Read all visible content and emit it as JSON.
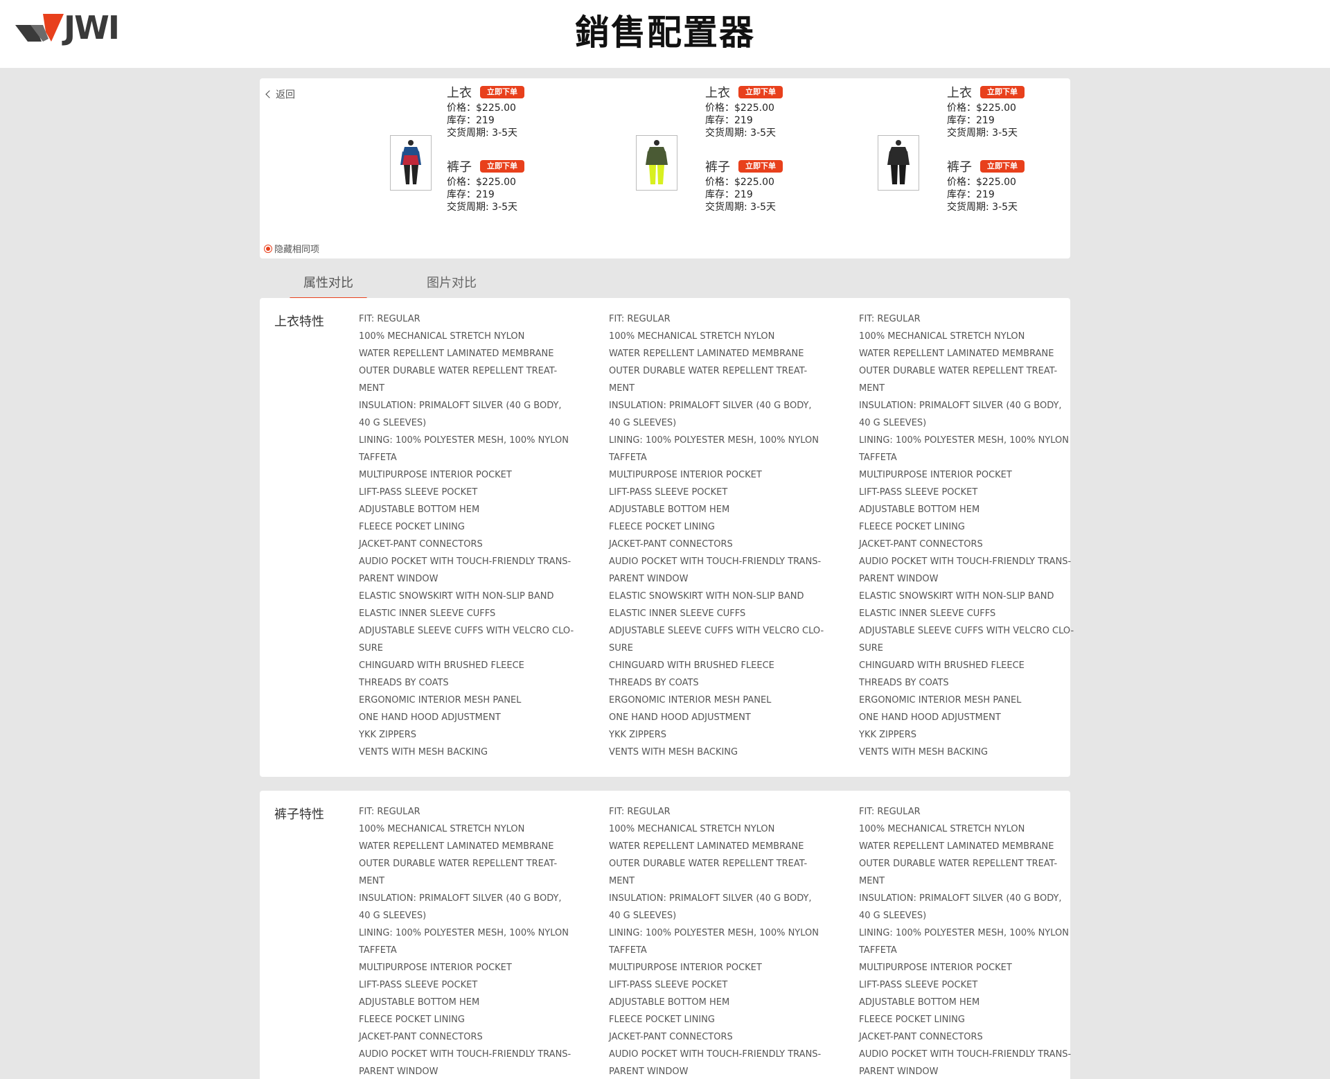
{
  "header": {
    "logo_text": "JWI",
    "title": "銷售配置器"
  },
  "compare": {
    "back_label": "返回",
    "hide_same_label": "隐藏相同项",
    "products": [
      {
        "items": [
          {
            "name": "上衣",
            "order_label": "立即下单",
            "price": "价格：$225.00",
            "stock": "库存：219",
            "lead": "交货周期: 3-5天"
          },
          {
            "name": "裤子",
            "order_label": "立即下单",
            "price": "价格：$225.00",
            "stock": "库存：219",
            "lead": "交货周期: 3-5天"
          }
        ]
      },
      {
        "items": [
          {
            "name": "上衣",
            "order_label": "立即下单",
            "price": "价格：$225.00",
            "stock": "库存：219",
            "lead": "交货周期: 3-5天"
          },
          {
            "name": "裤子",
            "order_label": "立即下单",
            "price": "价格：$225.00",
            "stock": "库存：219",
            "lead": "交货周期: 3-5天"
          }
        ]
      },
      {
        "items": [
          {
            "name": "上衣",
            "order_label": "立即下单",
            "price": "价格：$225.00",
            "stock": "库存：219",
            "lead": "交货周期: 3-5天"
          },
          {
            "name": "裤子",
            "order_label": "立即下单",
            "price": "价格：$225.00",
            "stock": "库存：219",
            "lead": "交货周期: 3-5天"
          }
        ]
      }
    ]
  },
  "tabs": [
    {
      "label": "属性对比",
      "active": true
    },
    {
      "label": "图片对比",
      "active": false
    }
  ],
  "sections": [
    {
      "title": "上衣特性",
      "columns": [
        [
          "FIT: REGULAR",
          "100% MECHANICAL STRETCH NYLON",
          "WATER REPELLENT LAMINATED MEMBRANE",
          "OUTER DURABLE WATER REPELLENT TREAT-",
          "MENT",
          "INSULATION: PRIMALOFT SILVER (40 G BODY,",
          "40 G SLEEVES)",
          "LINING: 100% POLYESTER MESH, 100% NYLON",
          "TAFFETA",
          "MULTIPURPOSE INTERIOR POCKET",
          "LIFT-PASS SLEEVE POCKET",
          "ADJUSTABLE BOTTOM HEM",
          "FLEECE POCKET LINING",
          "JACKET-PANT CONNECTORS",
          "AUDIO POCKET WITH TOUCH-FRIENDLY TRANS-",
          "PARENT WINDOW",
          "ELASTIC SNOWSKIRT WITH NON-SLIP BAND",
          "ELASTIC INNER SLEEVE CUFFS",
          "ADJUSTABLE SLEEVE CUFFS WITH VELCRO CLO-",
          "SURE",
          "CHINGUARD WITH BRUSHED FLEECE",
          "THREADS BY COATS",
          "ERGONOMIC INTERIOR MESH PANEL",
          "ONE HAND HOOD ADJUSTMENT",
          "YKK ZIPPERS",
          "VENTS WITH MESH BACKING"
        ],
        [
          "FIT: REGULAR",
          "100% MECHANICAL STRETCH NYLON",
          "WATER REPELLENT LAMINATED MEMBRANE",
          "OUTER DURABLE WATER REPELLENT TREAT-",
          "MENT",
          "INSULATION: PRIMALOFT SILVER (40 G BODY,",
          "40 G SLEEVES)",
          "LINING: 100% POLYESTER MESH, 100% NYLON",
          "TAFFETA",
          "MULTIPURPOSE INTERIOR POCKET",
          "LIFT-PASS SLEEVE POCKET",
          "ADJUSTABLE BOTTOM HEM",
          "FLEECE POCKET LINING",
          "JACKET-PANT CONNECTORS",
          "AUDIO POCKET WITH TOUCH-FRIENDLY TRANS-",
          "PARENT WINDOW",
          "ELASTIC SNOWSKIRT WITH NON-SLIP BAND",
          "ELASTIC INNER SLEEVE CUFFS",
          "ADJUSTABLE SLEEVE CUFFS WITH VELCRO CLO-",
          "SURE",
          "CHINGUARD WITH BRUSHED FLEECE",
          "THREADS BY COATS",
          "ERGONOMIC INTERIOR MESH PANEL",
          "ONE HAND HOOD ADJUSTMENT",
          "YKK ZIPPERS",
          "VENTS WITH MESH BACKING"
        ],
        [
          "FIT: REGULAR",
          "100% MECHANICAL STRETCH NYLON",
          "WATER REPELLENT LAMINATED MEMBRANE",
          "OUTER DURABLE WATER REPELLENT TREAT-",
          "MENT",
          "INSULATION: PRIMALOFT SILVER (40 G BODY,",
          "40 G SLEEVES)",
          "LINING: 100% POLYESTER MESH, 100% NYLON",
          "TAFFETA",
          "MULTIPURPOSE INTERIOR POCKET",
          "LIFT-PASS SLEEVE POCKET",
          "ADJUSTABLE BOTTOM HEM",
          "FLEECE POCKET LINING",
          "JACKET-PANT CONNECTORS",
          "AUDIO POCKET WITH TOUCH-FRIENDLY TRANS-",
          "PARENT WINDOW",
          "ELASTIC SNOWSKIRT WITH NON-SLIP BAND",
          "ELASTIC INNER SLEEVE CUFFS",
          "ADJUSTABLE SLEEVE CUFFS WITH VELCRO CLO-",
          "SURE",
          "CHINGUARD WITH BRUSHED FLEECE",
          "THREADS BY COATS",
          "ERGONOMIC INTERIOR MESH PANEL",
          "ONE HAND HOOD ADJUSTMENT",
          "YKK ZIPPERS",
          "VENTS WITH MESH BACKING"
        ]
      ]
    },
    {
      "title": "裤子特性",
      "columns": [
        [
          "FIT: REGULAR",
          "100% MECHANICAL STRETCH NYLON",
          "WATER REPELLENT LAMINATED MEMBRANE",
          "OUTER DURABLE WATER REPELLENT TREAT-",
          "MENT",
          "INSULATION: PRIMALOFT SILVER (40 G BODY,",
          "40 G SLEEVES)",
          "LINING: 100% POLYESTER MESH, 100% NYLON",
          "TAFFETA",
          "MULTIPURPOSE INTERIOR POCKET",
          "LIFT-PASS SLEEVE POCKET",
          "ADJUSTABLE BOTTOM HEM",
          "FLEECE POCKET LINING",
          "JACKET-PANT CONNECTORS",
          "AUDIO POCKET WITH TOUCH-FRIENDLY TRANS-",
          "PARENT WINDOW"
        ],
        [
          "FIT: REGULAR",
          "100% MECHANICAL STRETCH NYLON",
          "WATER REPELLENT LAMINATED MEMBRANE",
          "OUTER DURABLE WATER REPELLENT TREAT-",
          "MENT",
          "INSULATION: PRIMALOFT SILVER (40 G BODY,",
          "40 G SLEEVES)",
          "LINING: 100% POLYESTER MESH, 100% NYLON",
          "TAFFETA",
          "MULTIPURPOSE INTERIOR POCKET",
          "LIFT-PASS SLEEVE POCKET",
          "ADJUSTABLE BOTTOM HEM",
          "FLEECE POCKET LINING",
          "JACKET-PANT CONNECTORS",
          "AUDIO POCKET WITH TOUCH-FRIENDLY TRANS-",
          "PARENT WINDOW"
        ],
        [
          "FIT: REGULAR",
          "100% MECHANICAL STRETCH NYLON",
          "WATER REPELLENT LAMINATED MEMBRANE",
          "OUTER DURABLE WATER REPELLENT TREAT-",
          "MENT",
          "INSULATION: PRIMALOFT SILVER (40 G BODY,",
          "40 G SLEEVES)",
          "LINING: 100% POLYESTER MESH, 100% NYLON",
          "TAFFETA",
          "MULTIPURPOSE INTERIOR POCKET",
          "LIFT-PASS SLEEVE POCKET",
          "ADJUSTABLE BOTTOM HEM",
          "FLEECE POCKET LINING",
          "JACKET-PANT CONNECTORS",
          "AUDIO POCKET WITH TOUCH-FRIENDLY TRANS-",
          "PARENT WINDOW"
        ]
      ]
    }
  ],
  "colors": {
    "accent": "#e8401c",
    "background": "#e6e6e6"
  }
}
